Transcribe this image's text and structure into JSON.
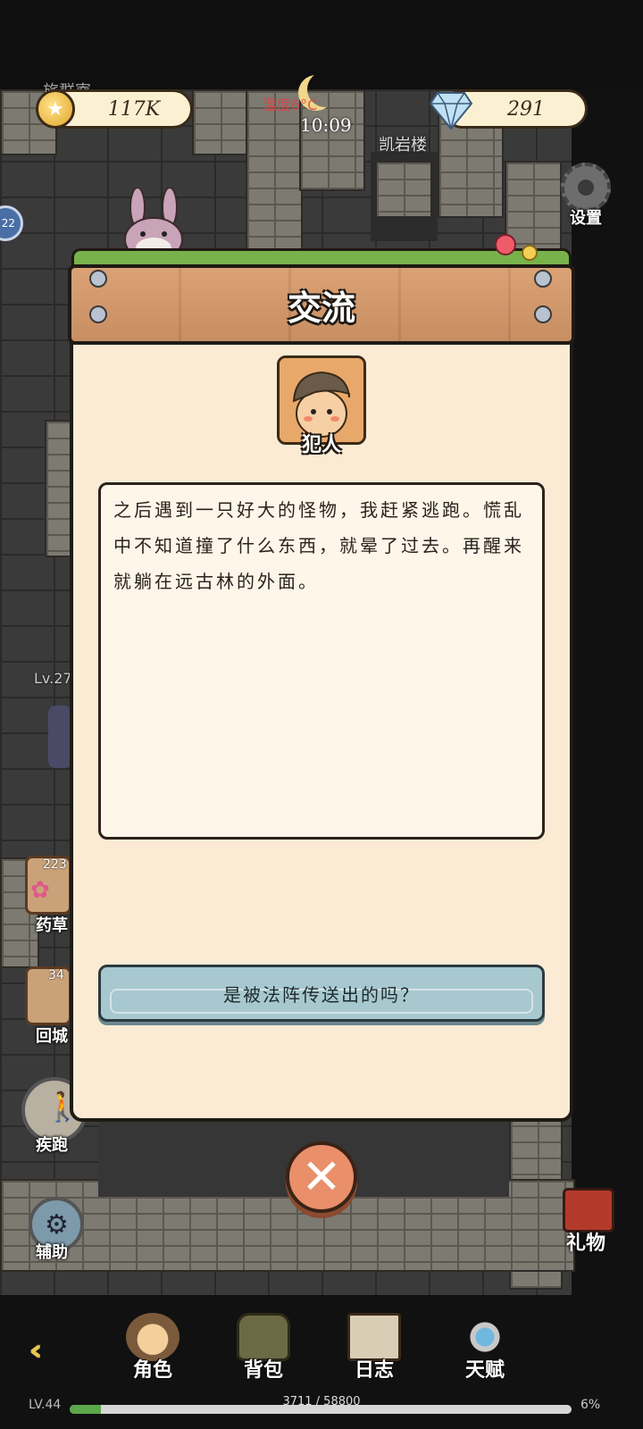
{
  "hud": {
    "gold": "117K",
    "gems": "291",
    "time": "10:09",
    "temperature": "温度6°C",
    "location": "凯岩楼",
    "settings_label": "设置",
    "top_left_partial": "旅群寮"
  },
  "left_panel": {
    "player_level": "Lv.27",
    "herb_count": "223",
    "herb_label": "药草",
    "return_count": "34",
    "return_label": "回城",
    "sprint_label": "疾跑",
    "assist_label": "辅助",
    "badge_number": "22"
  },
  "right_panel": {
    "gift_label": "礼物"
  },
  "modal": {
    "title": "交流",
    "npc_name": "犯人",
    "dialog_text": "之后遇到一只好大的怪物，我赶紧逃跑。慌乱中不知道撞了什么东西，就晕了过去。再醒来就躺在远古林的外面。",
    "choice": "是被法阵传送出的吗？",
    "close": "✕"
  },
  "bottom_nav": {
    "items": [
      {
        "label": "角色",
        "icon": "character-icon"
      },
      {
        "label": "背包",
        "icon": "backpack-icon"
      },
      {
        "label": "日志",
        "icon": "journal-icon"
      },
      {
        "label": "天赋",
        "icon": "talent-icon"
      }
    ],
    "back": "«"
  },
  "progress": {
    "level": "LV.44",
    "xp_text": "3711 / 58800",
    "percent": "6%",
    "fraction": 0.063
  },
  "colors": {
    "accent_green": "#5ca84a",
    "wood": "#d89a6a",
    "parchment": "#fcebd4",
    "choice_blue": "#a7c8cf"
  }
}
